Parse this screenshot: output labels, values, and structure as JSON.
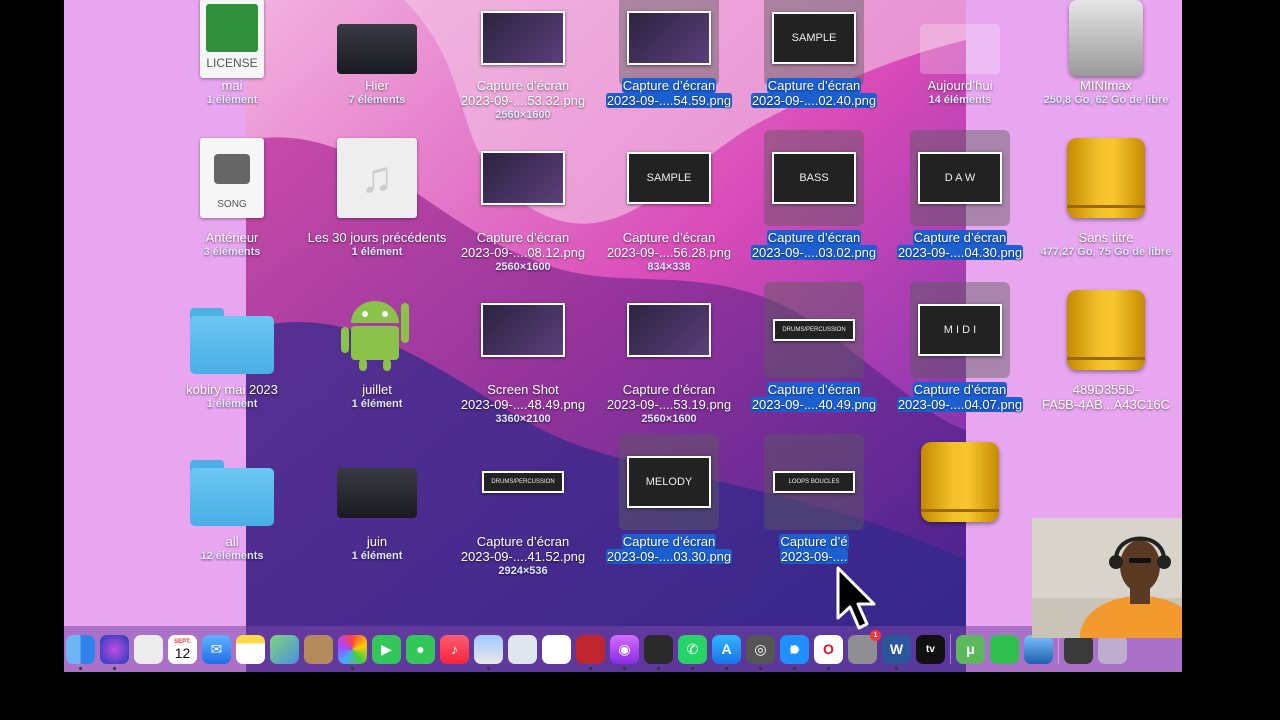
{
  "desktop": {
    "icons": [
      {
        "name": "mai",
        "sub": "1 élément",
        "kind": "doc-license",
        "badge": "LICENSE"
      },
      {
        "name": "Hier",
        "sub": "7 éléments",
        "kind": "folder-dark"
      },
      {
        "name": "Capture d’écran",
        "file": "2023-09-....53.32.png",
        "dims": "2560×1600",
        "kind": "shot"
      },
      {
        "name": "Capture d’écran",
        "file": "2023-09-....54.59.png",
        "kind": "shot",
        "selected": true
      },
      {
        "name": "Capture d’écran",
        "file": "2023-09-....02.40.png",
        "kind": "shot",
        "selected": true,
        "thumb_text": "SAMPLE"
      },
      {
        "name": "Aujourd’hui",
        "sub": "14 éléments",
        "kind": "folder-faded"
      },
      {
        "name": "MINImax",
        "sub": "250,8 Go, 62 Go de libre",
        "kind": "hdd"
      },
      {
        "name": "Antérieur",
        "sub": "3 éléments",
        "kind": "doc-song",
        "badge": "SONG"
      },
      {
        "name": "Les 30 jours précédents",
        "sub": "1 élément",
        "kind": "music"
      },
      {
        "name": "Capture d’écran",
        "file": "2023-09-....08.12.png",
        "dims": "2560×1600",
        "kind": "shot"
      },
      {
        "name": "Capture d’écran",
        "file": "2023-09-....56.28.png",
        "dims": "834×338",
        "kind": "shot",
        "thumb_text": "SAMPLE"
      },
      {
        "name": "Capture d’écran",
        "file": "2023-09-....03.02.png",
        "kind": "shot",
        "selected": true,
        "thumb_text": "BASS"
      },
      {
        "name": "Capture d’écran",
        "file": "2023-09-....04.30.png",
        "kind": "shot",
        "selected": true,
        "thumb_text": "D  A  W"
      },
      {
        "name": "Sans titre",
        "sub": "477,27 Go, 75 Go de libre",
        "kind": "drive"
      },
      {
        "name": "kobiry mai 2023",
        "sub": "1 élément",
        "kind": "folder"
      },
      {
        "name": "juillet",
        "sub": "1 élément",
        "kind": "android"
      },
      {
        "name": "Screen Shot",
        "file": "2023-09-....48.49.png",
        "dims": "3360×2100",
        "kind": "shot"
      },
      {
        "name": "Capture d’écran",
        "file": "2023-09-....53.19.png",
        "dims": "2560×1600",
        "kind": "shot"
      },
      {
        "name": "Capture d’écran",
        "file": "2023-09-....40.49.png",
        "kind": "shot",
        "selected": true,
        "thumb_text": "DRUMS/PERCUSSION"
      },
      {
        "name": "Capture d’écran",
        "file": "2023-09-....04.07.png",
        "kind": "shot",
        "selected": true,
        "thumb_text": "M I D I"
      },
      {
        "name": "489D355D-",
        "file": "FA5B-4AB...A43C16C",
        "kind": "drive"
      },
      {
        "name": "all",
        "sub": "12 éléments",
        "kind": "folder"
      },
      {
        "name": "juin",
        "sub": "1 élément",
        "kind": "folder-dark"
      },
      {
        "name": "Capture d’écran",
        "file": "2023-09-....41.52.png",
        "dims": "2924×536",
        "kind": "shot",
        "thumb_text": "DRUMS/PERCUSSION"
      },
      {
        "name": "Capture d’écran",
        "file": "2023-09-....03.30.png",
        "kind": "shot",
        "selected": true,
        "thumb_text": "MELODY"
      },
      {
        "name": "Capture d’é",
        "file": "2023-09-....",
        "kind": "shot",
        "selected": true,
        "thumb_text": "LOOPS BOUCLES"
      },
      {
        "name": "",
        "kind": "drive"
      }
    ]
  },
  "dock": {
    "calendar_month": "SEPT.",
    "calendar_day": "12",
    "badge_count": "1",
    "appletv_label": "tv",
    "items": [
      "finder",
      "siri",
      "launchpad",
      "calendar",
      "mail",
      "notes",
      "maps",
      "contacts",
      "photos",
      "facetime",
      "messages",
      "music",
      "preview",
      "disk-utility",
      "voice-memos",
      "photo-booth",
      "podcasts",
      "logic",
      "whatsapp",
      "app-store",
      "screenshot",
      "safari",
      "opera",
      "system-preferences",
      "word",
      "apple-tv",
      "utorrent",
      "numbers",
      "quicktime",
      "recent-window",
      "trash"
    ]
  },
  "colors": {
    "selection": "#1b5fd1",
    "sidebar_pink": "#e9a6f0",
    "drive_gold": "#f2c02a",
    "folder_blue": "#5bbbee"
  }
}
